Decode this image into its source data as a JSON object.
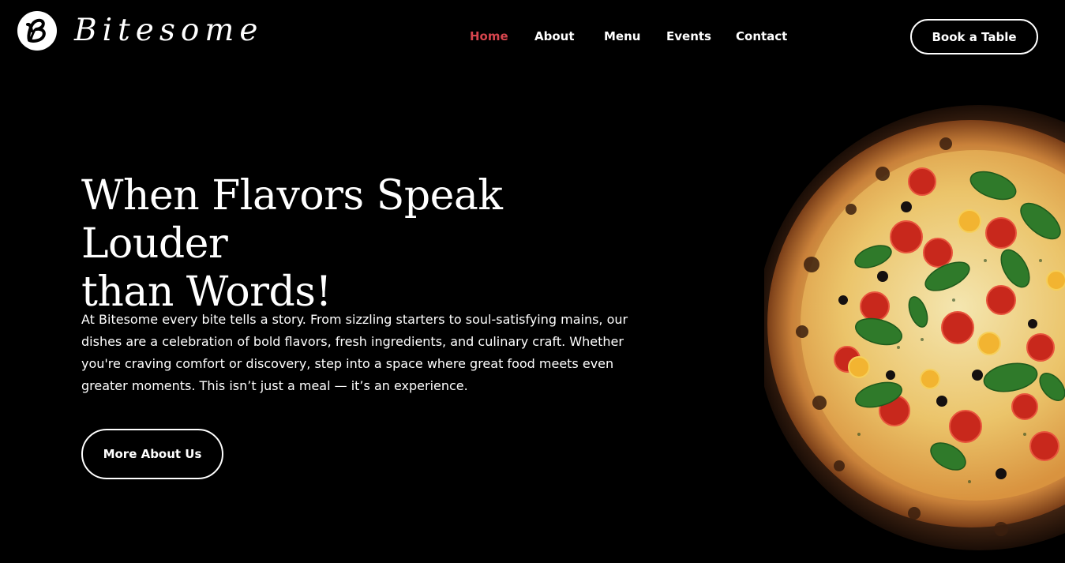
{
  "header": {
    "brand": "Bitesome",
    "logo_icon": "b-monogram-logo",
    "nav": [
      {
        "label": "Home",
        "active": true
      },
      {
        "label": "About",
        "active": false
      },
      {
        "label": "Menu",
        "active": false
      },
      {
        "label": "Events",
        "active": false
      },
      {
        "label": "Contact",
        "active": false
      }
    ],
    "cta_label": "Book a Table"
  },
  "hero": {
    "title_line1": "When Flavors Speak Louder",
    "title_line2": "than Words!",
    "description": "At Bitesome every bite tells a story. From sizzling starters to soul-satisfying mains, our dishes are a celebration of bold flavors, fresh ingredients, and culinary craft. Whether you're craving comfort or discovery, step into a space where great food meets even greater moments. This isn’t just a meal — it’s an experience.",
    "button_label": "More About Us",
    "image": "pizza-on-wooden-board"
  },
  "colors": {
    "background": "#000000",
    "text": "#ffffff",
    "accent": "#d6454d"
  }
}
